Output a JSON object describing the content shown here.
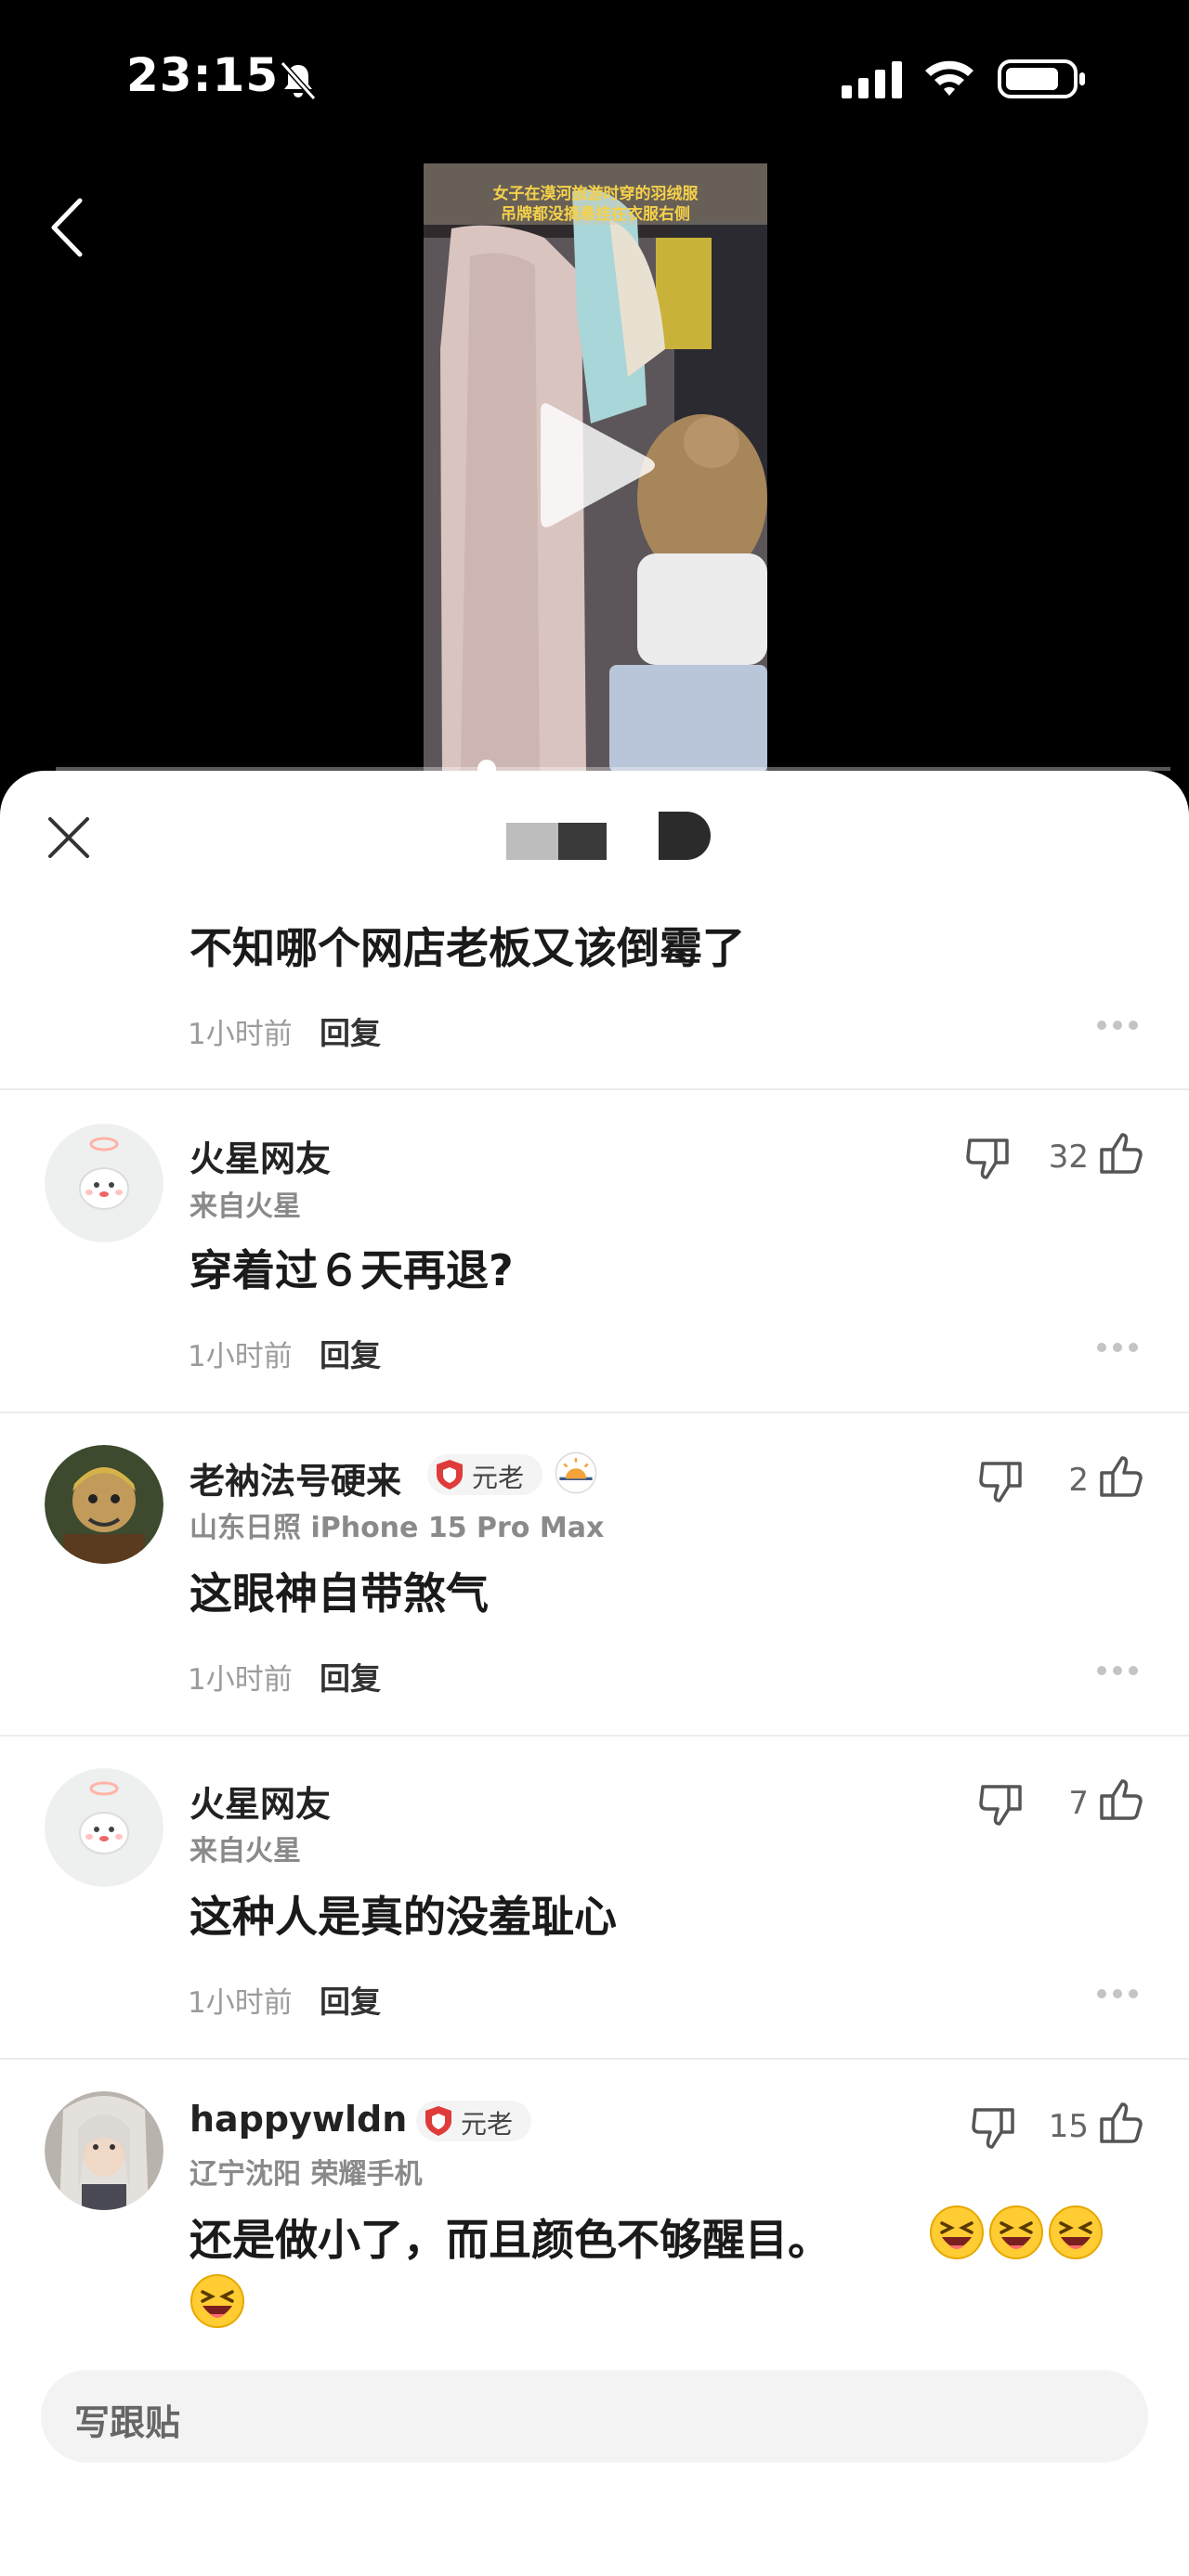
{
  "status_bar": {
    "time": "23:15"
  },
  "video": {
    "caption_line1": "女子在漠河旅游时穿的羽绒服",
    "caption_line2": "吊牌都没摘悬挂在衣服右侧"
  },
  "comments": [
    {
      "text": "不知哪个网店老板又该倒霉了",
      "time": "1小时前",
      "reply": "回复"
    },
    {
      "user": "火星网友",
      "location": "来自火星",
      "text": "穿着过６天再退?",
      "time": "1小时前",
      "reply": "回复",
      "likes": "32"
    },
    {
      "user": "老衲法号硬来",
      "badge": "元老",
      "location": "山东日照  iPhone 15 Pro Max",
      "text": "这眼神自带煞气",
      "time": "1小时前",
      "reply": "回复",
      "likes": "2"
    },
    {
      "user": "火星网友",
      "location": "来自火星",
      "text": "这种人是真的没羞耻心",
      "time": "1小时前",
      "reply": "回复",
      "likes": "7"
    },
    {
      "user": "happywldn",
      "badge": "元老",
      "location": "辽宁沈阳  荣耀手机",
      "text": "还是做小了，而且颜色不够醒目。",
      "likes": "15"
    }
  ],
  "compose": {
    "placeholder": "写跟贴"
  }
}
